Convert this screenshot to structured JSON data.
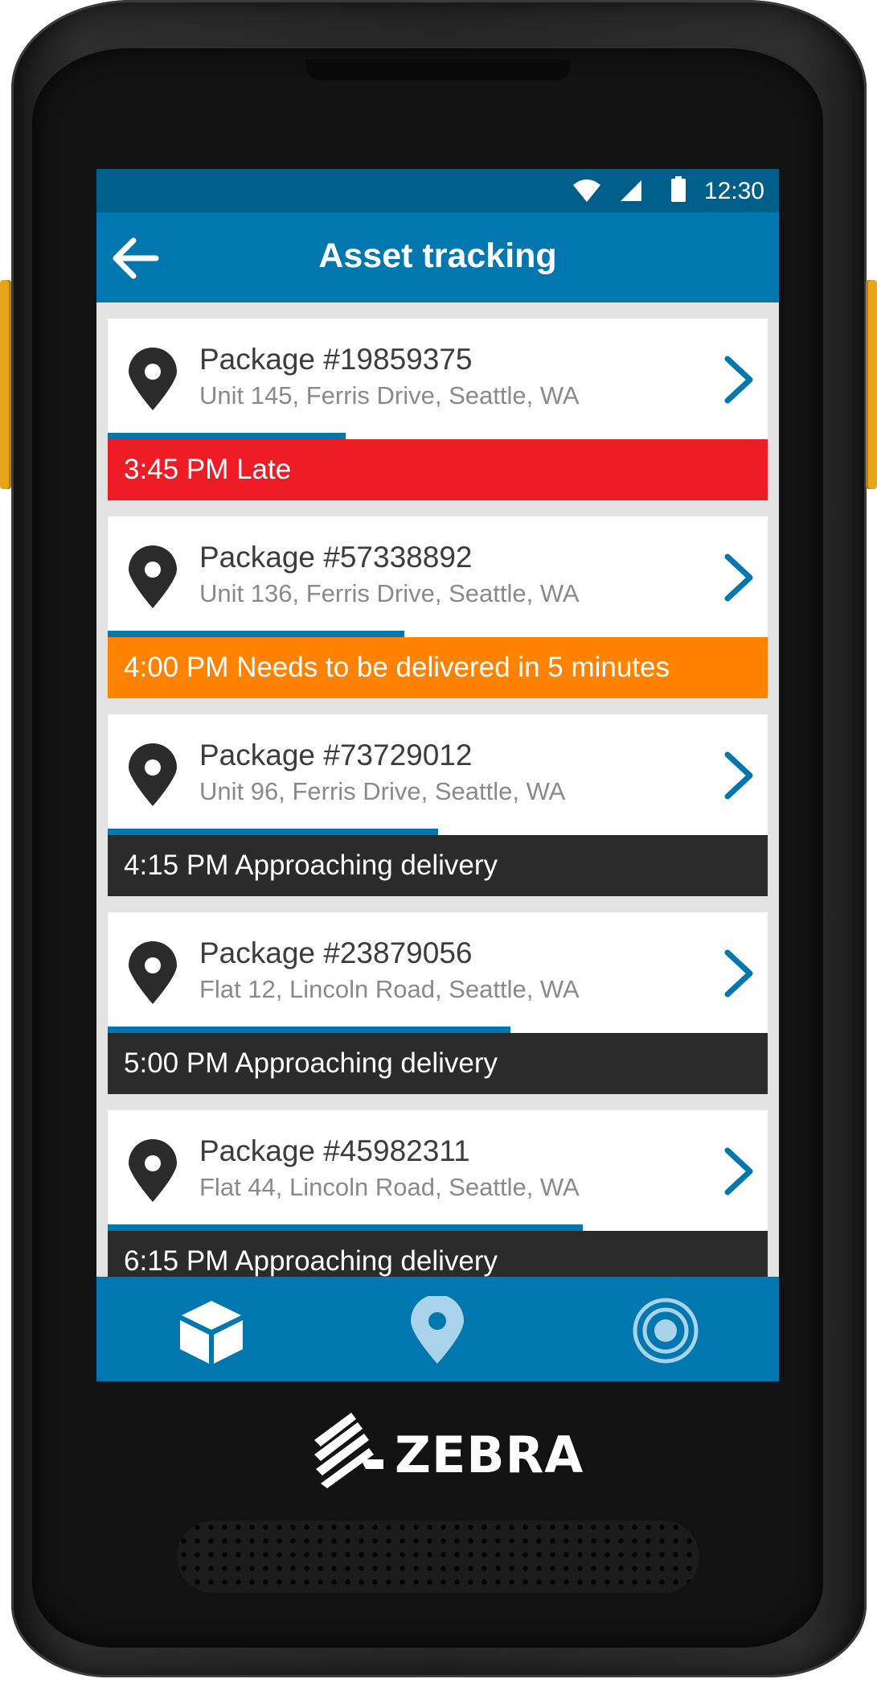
{
  "status_bar": {
    "time": "12:30",
    "icons": [
      "wifi-icon",
      "cell-signal-icon",
      "battery-icon"
    ]
  },
  "app_bar": {
    "title": "Asset tracking",
    "back_icon": "arrow-left-icon"
  },
  "packages": [
    {
      "name": "Package #19859375",
      "address": "Unit 145, Ferris Drive, Seattle, WA",
      "status": "3:45 PM Late",
      "status_color": "#ee1c25",
      "progress": 0.36
    },
    {
      "name": "Package #57338892",
      "address": "Unit 136, Ferris Drive, Seattle, WA",
      "status": "4:00 PM Needs to be delivered in 5 minutes",
      "status_color": "#ff8200",
      "progress": 0.45
    },
    {
      "name": "Package #73729012",
      "address": "Unit 96, Ferris Drive, Seattle, WA",
      "status": "4:15 PM Approaching delivery",
      "status_color": "#2b2b2b",
      "progress": 0.5
    },
    {
      "name": "Package #23879056",
      "address": "Flat 12, Lincoln Road, Seattle, WA",
      "status": "5:00 PM Approaching delivery",
      "status_color": "#2b2b2b",
      "progress": 0.61
    },
    {
      "name": "Package #45982311",
      "address": "Flat 44, Lincoln Road, Seattle, WA",
      "status": "6:15 PM Approaching delivery",
      "status_color": "#2b2b2b",
      "progress": 0.72
    }
  ],
  "bottom_nav": {
    "items": [
      "box-icon",
      "location-pin-icon",
      "target-icon"
    ]
  },
  "brand": {
    "name": "ZEBRA"
  },
  "colors": {
    "primary": "#0078af",
    "primary_dark": "#005f8a",
    "late": "#ee1c25",
    "warning": "#ff8200",
    "neutral": "#2b2b2b",
    "device_button": "#e7a51b"
  }
}
